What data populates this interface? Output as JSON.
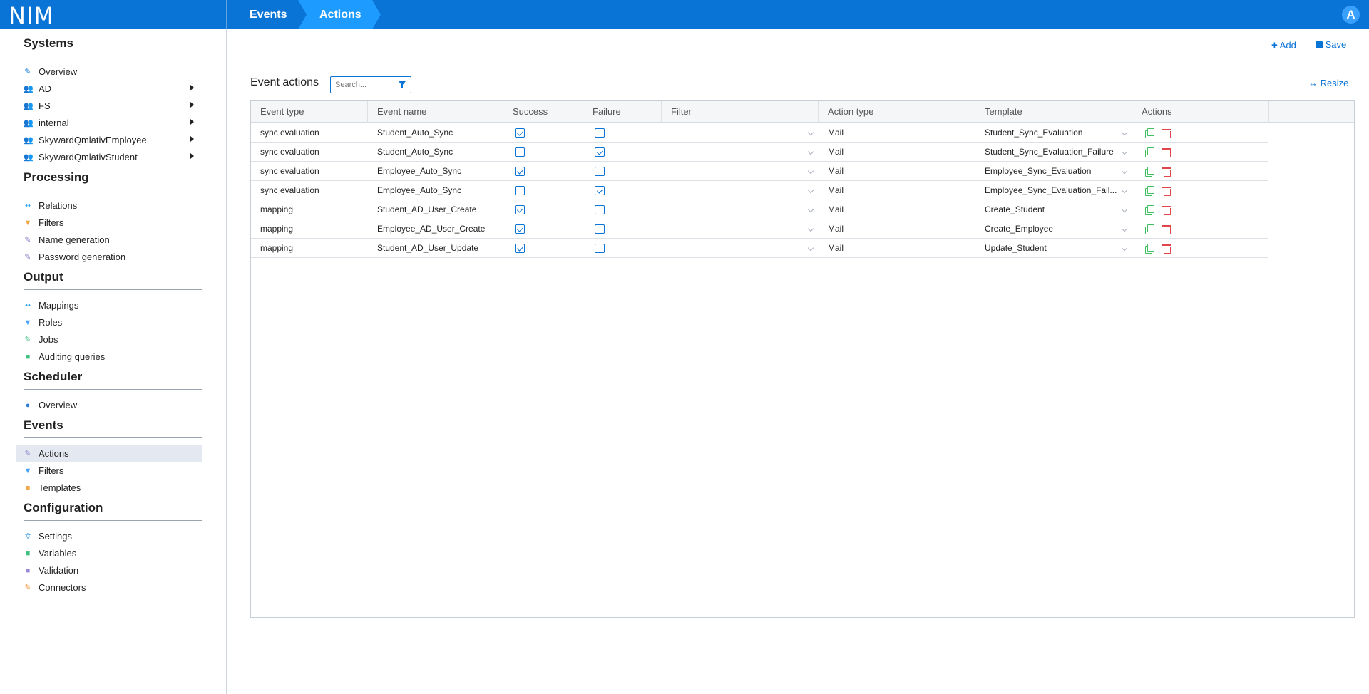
{
  "app": {
    "brand": "NIM",
    "avatar_letter": "A",
    "accent": "#0a73d6"
  },
  "breadcrumb": [
    "Events",
    "Actions"
  ],
  "sidebar": {
    "sections": [
      {
        "title": "Systems",
        "items": [
          {
            "label": "Overview",
            "icon": "wrench-icon",
            "arrow": false
          },
          {
            "label": "AD",
            "icon": "user-group-icon",
            "arrow": true
          },
          {
            "label": "FS",
            "icon": "user-group-icon",
            "arrow": true
          },
          {
            "label": "internal",
            "icon": "user-group-icon",
            "arrow": true
          },
          {
            "label": "SkywardQmlativEmployee",
            "icon": "user-group-icon",
            "arrow": true
          },
          {
            "label": "SkywardQmlativStudent",
            "icon": "user-group-icon",
            "arrow": true
          }
        ]
      },
      {
        "title": "Processing",
        "items": [
          {
            "label": "Relations",
            "icon": "relations-icon",
            "arrow": false
          },
          {
            "label": "Filters",
            "icon": "filter-icon",
            "arrow": false
          },
          {
            "label": "Name generation",
            "icon": "edit-icon",
            "arrow": false
          },
          {
            "label": "Password generation",
            "icon": "edit-icon",
            "arrow": false
          }
        ]
      },
      {
        "title": "Output",
        "items": [
          {
            "label": "Mappings",
            "icon": "relations-icon",
            "arrow": false
          },
          {
            "label": "Roles",
            "icon": "filter-icon",
            "arrow": false
          },
          {
            "label": "Jobs",
            "icon": "edit-icon",
            "arrow": false
          },
          {
            "label": "Auditing queries",
            "icon": "document-icon",
            "arrow": false
          }
        ]
      },
      {
        "title": "Scheduler",
        "items": [
          {
            "label": "Overview",
            "icon": "clock-icon",
            "arrow": false
          }
        ]
      },
      {
        "title": "Events",
        "items": [
          {
            "label": "Actions",
            "icon": "wrench-icon",
            "arrow": false,
            "active": true
          },
          {
            "label": "Filters",
            "icon": "filter-icon",
            "arrow": false
          },
          {
            "label": "Templates",
            "icon": "document-icon",
            "arrow": false
          }
        ]
      },
      {
        "title": "Configuration",
        "items": [
          {
            "label": "Settings",
            "icon": "gear-icon",
            "arrow": false
          },
          {
            "label": "Variables",
            "icon": "document-icon",
            "arrow": false
          },
          {
            "label": "Validation",
            "icon": "document-icon",
            "arrow": false
          },
          {
            "label": "Connectors",
            "icon": "wrench-icon",
            "arrow": false
          }
        ]
      }
    ]
  },
  "toolbar": {
    "add_label": "Add",
    "save_label": "Save"
  },
  "panel": {
    "title": "Event actions",
    "search_placeholder": "Search...",
    "resize_label": "Resize"
  },
  "table": {
    "columns": [
      "Event type",
      "Event name",
      "Success",
      "Failure",
      "Filter",
      "Action type",
      "Template",
      "Actions"
    ],
    "rows": [
      {
        "event_type": "sync evaluation",
        "event_name": "Student_Auto_Sync",
        "success": true,
        "failure": false,
        "filter": "",
        "action_type": "Mail",
        "template": "Student_Sync_Evaluation"
      },
      {
        "event_type": "sync evaluation",
        "event_name": "Student_Auto_Sync",
        "success": false,
        "failure": true,
        "filter": "",
        "action_type": "Mail",
        "template": "Student_Sync_Evaluation_Failure"
      },
      {
        "event_type": "sync evaluation",
        "event_name": "Employee_Auto_Sync",
        "success": true,
        "failure": false,
        "filter": "",
        "action_type": "Mail",
        "template": "Employee_Sync_Evaluation"
      },
      {
        "event_type": "sync evaluation",
        "event_name": "Employee_Auto_Sync",
        "success": false,
        "failure": true,
        "filter": "",
        "action_type": "Mail",
        "template": "Employee_Sync_Evaluation_Fail..."
      },
      {
        "event_type": "mapping",
        "event_name": "Student_AD_User_Create",
        "success": true,
        "failure": false,
        "filter": "",
        "action_type": "Mail",
        "template": "Create_Student"
      },
      {
        "event_type": "mapping",
        "event_name": "Employee_AD_User_Create",
        "success": true,
        "failure": false,
        "filter": "",
        "action_type": "Mail",
        "template": "Create_Employee"
      },
      {
        "event_type": "mapping",
        "event_name": "Student_AD_User_Update",
        "success": true,
        "failure": false,
        "filter": "",
        "action_type": "Mail",
        "template": "Update_Student"
      }
    ]
  }
}
